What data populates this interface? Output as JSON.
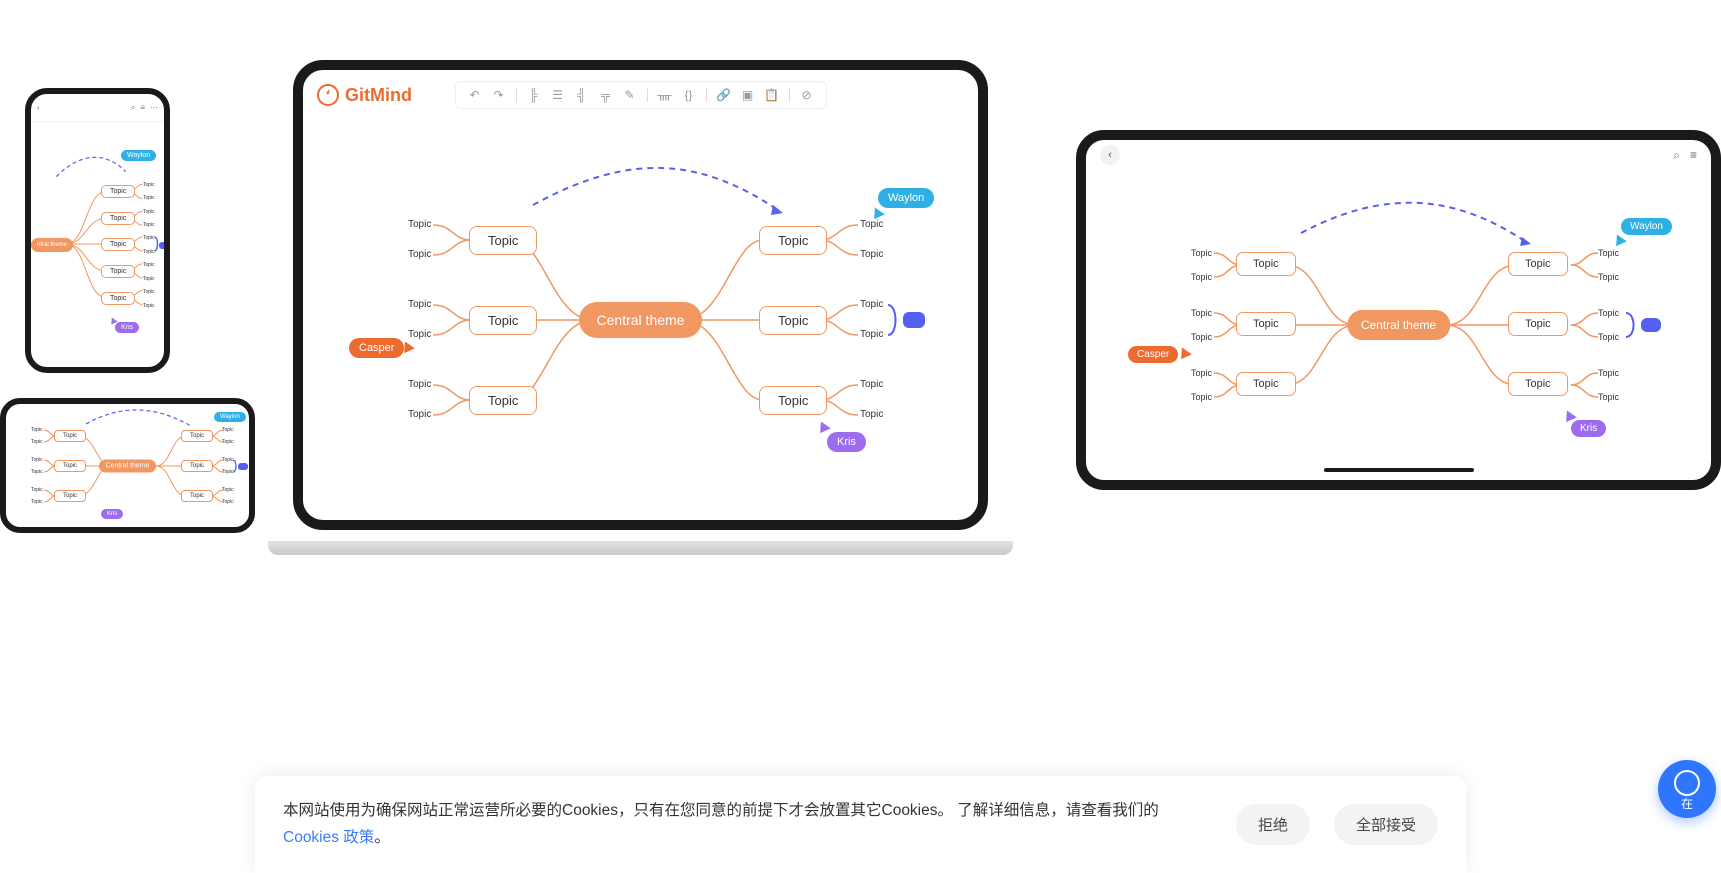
{
  "brand": {
    "name": "GitMind"
  },
  "mindmap": {
    "center": "Central  theme",
    "node": "Topic",
    "sub": "Topic",
    "users": {
      "waylon": "Waylon",
      "casper": "Casper",
      "kris": "Kris"
    }
  },
  "phone": {
    "toolbar": {
      "back": "‹",
      "search": "⌕",
      "list": "≡",
      "more": "⋯"
    },
    "center": "ntral  theme"
  },
  "tablet": {
    "toolbar": {
      "back": "‹",
      "search": "⌕",
      "list": "≡"
    }
  },
  "toolbar": {
    "icons": [
      "↶",
      "↷",
      "|",
      "⊞",
      "⊟",
      "⊡",
      "⊠",
      "⋔",
      "|",
      "⚙",
      "{}",
      "|",
      "🔗",
      "▢",
      "📋",
      "|",
      "⊘"
    ]
  },
  "cookie": {
    "text1": "本网站使用为确保网站正常运营所必要的Cookies，只有在您同意的前提下才会放置其它Cookies。 了解详细信息，请查看我们的",
    "link": "Cookies 政策",
    "text2": "。",
    "reject": "拒绝",
    "accept": "全部接受"
  },
  "fab": {
    "label": "在"
  }
}
